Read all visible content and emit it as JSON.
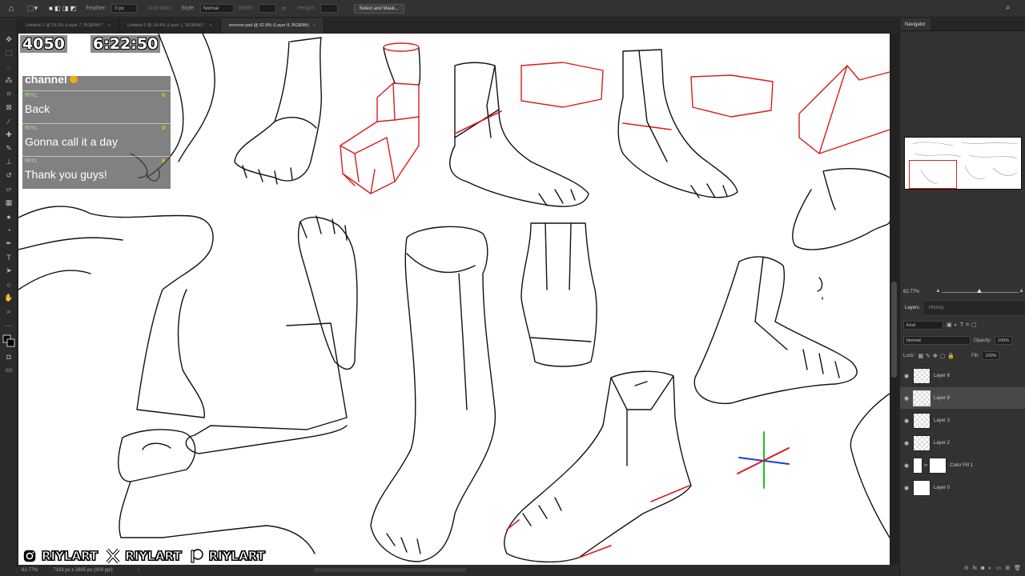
{
  "options_bar": {
    "feather_label": "Feather:",
    "feather_value": "0 px",
    "antialias_label": "Anti-alias",
    "style_label": "Style:",
    "style_value": "Normal",
    "width_label": "Width:",
    "height_label": "Height:",
    "select_mask_button": "Select and Mask..."
  },
  "tabs": [
    {
      "label": "Untitled-1 @ 29.5% (Layer 7, RGB/8#) *"
    },
    {
      "label": "Untitled-2 @ 24.4% (Layer 1, RGB/8#) *"
    },
    {
      "label": "erererer.psd @ 62.8% (Layer 8, RGB/8#)"
    }
  ],
  "panels": {
    "navigator_tab": "Navigator",
    "navigator_zoom": "62.77%",
    "layers_tab": "Layers",
    "history_tab": "History",
    "kind_filter": "Kind",
    "blend_mode": "Normal",
    "opacity_label": "Opacity:",
    "opacity_value": "100%",
    "lock_label": "Lock:",
    "fill_label": "Fill:",
    "fill_value": "100%"
  },
  "layers": [
    {
      "name": "Layer 6",
      "selected": false
    },
    {
      "name": "Layer 8",
      "selected": true
    },
    {
      "name": "Layer 3",
      "selected": false
    },
    {
      "name": "Layer 2",
      "selected": false
    },
    {
      "name": "Color Fill 1",
      "selected": false
    },
    {
      "name": "Layer 0",
      "selected": false
    }
  ],
  "status": {
    "zoom": "62.77%",
    "doc_info": "7193 px x 2805 px (300 ppi)"
  },
  "overlay": {
    "counter": "4050",
    "timer": "6:22:50",
    "chat_top_fragment": "channel",
    "messages": [
      {
        "user": "RIYL",
        "text": "Back"
      },
      {
        "user": "RIYL",
        "text": "Gonna call it a day"
      },
      {
        "user": "RIYL",
        "text": "Thank you guys!"
      }
    ],
    "socials": [
      {
        "icon": "instagram-icon",
        "name": "RIYLART"
      },
      {
        "icon": "x-icon",
        "name": "RIYLART"
      },
      {
        "icon": "patreon-icon",
        "name": "RIYLART"
      }
    ]
  },
  "colors": {
    "panel_bg": "#323232",
    "canvas_bg": "#ffffff",
    "sketch_red": "#d91c1c",
    "chat_user": "#8fd47a",
    "crown": "#f3c10f"
  }
}
